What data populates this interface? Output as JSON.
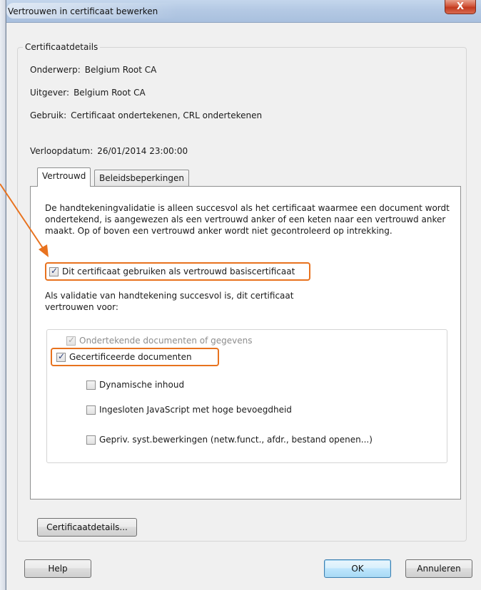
{
  "window": {
    "title": "Vertrouwen in certificaat bewerken",
    "close_glyph": "X"
  },
  "details": {
    "legend": "Certificaatdetails",
    "onderwerp": {
      "label": "Onderwerp:",
      "value": "Belgium Root CA"
    },
    "uitgever": {
      "label": "Uitgever:",
      "value": "Belgium Root CA"
    },
    "gebruik": {
      "label": "Gebruik:",
      "value": "Certificaat ondertekenen, CRL ondertekenen"
    },
    "verloopdatum": {
      "label": "Verloopdatum:",
      "value": "26/01/2014 23:00:00"
    }
  },
  "tabs": [
    {
      "label": "Vertrouwd",
      "active": true
    },
    {
      "label": "Beleidsbeperkingen",
      "active": false
    }
  ],
  "trust": {
    "description": "De handtekeningvalidatie is alleen succesvol als het certificaat waarmee een document wordt ondertekend, is aangewezen als een vertrouwd anker of een keten naar een vertrouwd anker maakt. Op of boven een vertrouwd anker wordt niet gecontroleerd op intrekking.",
    "root_checkbox": {
      "label": "Dit certificaat gebruiken als vertrouwd basiscertificaat",
      "checked": true
    },
    "validation_text": "Als validatie van handtekening succesvol is, dit certificaat vertrouwen voor:",
    "options": [
      {
        "label": "Ondertekende documenten of gegevens",
        "checked": true,
        "disabled": true
      },
      {
        "label": "Gecertificeerde documenten",
        "checked": true,
        "disabled": false
      },
      {
        "label": "Dynamische inhoud",
        "checked": false,
        "disabled": false
      },
      {
        "label": "Ingesloten JavaScript met hoge bevoegdheid",
        "checked": false,
        "disabled": false
      },
      {
        "label": "Gepriv. syst.bewerkingen (netw.funct., afdr., bestand openen...)",
        "checked": false,
        "disabled": false
      }
    ]
  },
  "buttons": {
    "details": "Certificaatdetails...",
    "help": "Help",
    "ok": "OK",
    "cancel": "Annuleren"
  },
  "colors": {
    "highlight": "#e8721e",
    "titlebar": "#b4c9e4",
    "dialog_bg": "#f0f0f0"
  }
}
